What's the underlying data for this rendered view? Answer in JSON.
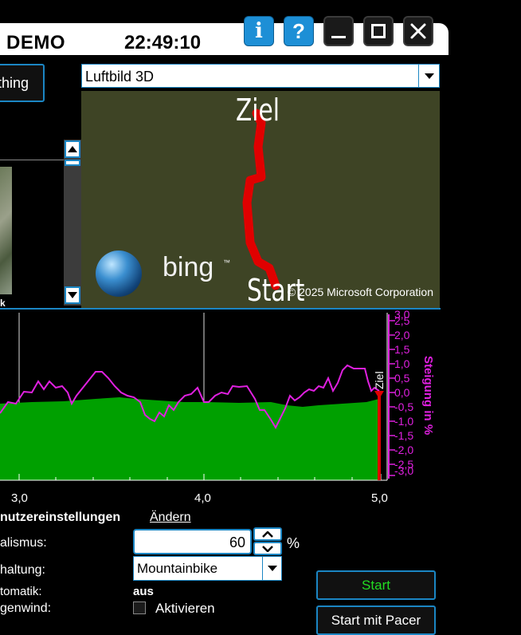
{
  "header": {
    "title": "DEMO",
    "clock": "22:49:10",
    "info_glyph": "i",
    "help_glyph": "?"
  },
  "toolbar": {
    "left_button_label": "thing"
  },
  "map": {
    "view_select_value": "Luftbild 3D",
    "finish_label": "Ziel",
    "start_label": "Start",
    "logo_text": "bing",
    "logo_tm": "™",
    "copyright": "© 2025 Microsoft Corporation"
  },
  "left_panel": {
    "thumb_caption": "k"
  },
  "profile": {
    "x_ticks": [
      "3,0",
      "4,0",
      "5,0"
    ],
    "y_ticks": [
      "3,0",
      "2,5",
      "2,0",
      "1,5",
      "1,0",
      "0,5",
      "0,0",
      "-0,5",
      "-1,0",
      "-1,5",
      "-2,0",
      "-2,5",
      "-3,0"
    ],
    "y_axis_label": "Steigung in %",
    "finish_marker_label": "Ziel",
    "colors": {
      "elevation_fill": "#00a000",
      "gradient_line": "#e020e0",
      "axis": "#e020e0",
      "marker": "#e00000"
    }
  },
  "settings": {
    "section_title": "nutzereinstellungen",
    "change_link": "Ändern",
    "realism_label": "alismus:",
    "realism_value": "60",
    "realism_unit": "%",
    "gear_label": "haltung:",
    "gear_value": "Mountainbike",
    "auto_label": "tomatik:",
    "auto_value": "aus",
    "wind_label": "genwind:",
    "wind_checkbox_label": "Aktivieren"
  },
  "actions": {
    "start_label": "Start",
    "start_pacer_label": "Start mit Pacer",
    "start_color": "#22dd22"
  }
}
